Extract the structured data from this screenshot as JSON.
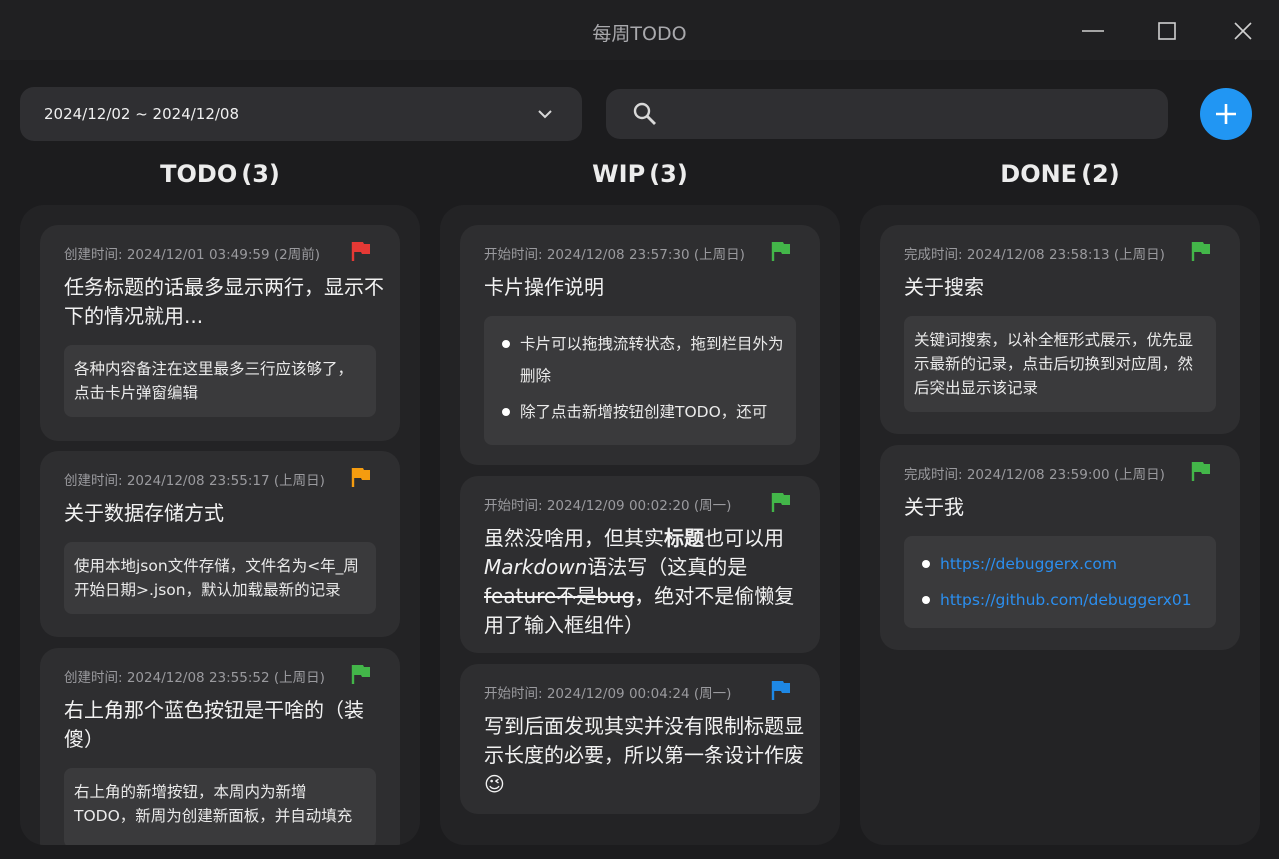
{
  "window": {
    "title": "每周TODO"
  },
  "toolbar": {
    "week_range": "2024/12/02 ~ 2024/12/08",
    "search_placeholder": "",
    "add_icon": "plus-icon",
    "accent": "#2196f3"
  },
  "columns": [
    {
      "name": "TODO",
      "count": "(3)",
      "cards": [
        {
          "meta": "创建时间: 2024/12/01 03:49:59 (2周前)",
          "flag": "#e53935",
          "title": "任务标题的话最多显示两行，显示不下的情况就用...",
          "note": "各种内容备注在这里最多三行应该够了，点击卡片弹窗编辑"
        },
        {
          "meta": "创建时间: 2024/12/08 23:55:17 (上周日)",
          "flag": "#f59c0f",
          "title": "关于数据存储方式",
          "note": "使用本地json文件存储，文件名为<年_周开始日期>.json，默认加载最新的记录"
        },
        {
          "meta": "创建时间: 2024/12/08 23:55:52 (上周日)",
          "flag": "#43b649",
          "title": "右上角那个蓝色按钮是干啥的（装傻）",
          "note": "右上角的新增按钮，本周内为新增TODO，新周为创建新面板，并自动填充"
        }
      ]
    },
    {
      "name": "WIP",
      "count": "(3)",
      "cards": [
        {
          "meta": "开始时间: 2024/12/08 23:57:30 (上周日)",
          "flag": "#43b649",
          "title": "卡片操作说明",
          "bullets": [
            "卡片可以拖拽流转状态，拖到栏目外为删除",
            "除了点击新增按钮创建TODO，还可"
          ]
        },
        {
          "meta": "开始时间: 2024/12/09 00:02:20 (周一)",
          "flag": "#43b649",
          "title_parts": {
            "a": "虽然没啥用，但其实",
            "b": "标题",
            "c": "也可以用",
            "d": "Markdown",
            "e": "语法写（这真的是",
            "f": "feature不是bug",
            "g": "，绝对不是偷懒复用了输入框组件）"
          }
        },
        {
          "meta": "开始时间: 2024/12/09 00:04:24 (周一)",
          "flag": "#1e88e5",
          "title": "写到后面发现其实并没有限制标题显示长度的必要，所以第一条设计作废😉"
        }
      ]
    },
    {
      "name": "DONE",
      "count": "(2)",
      "cards": [
        {
          "meta": "完成时间: 2024/12/08 23:58:13 (上周日)",
          "flag": "#43b649",
          "title": "关于搜索",
          "note": "关键词搜索，以补全框形式展示，优先显示最新的记录，点击后切换到对应周，然后突出显示该记录"
        },
        {
          "meta": "完成时间: 2024/12/08 23:59:00 (上周日)",
          "flag": "#43b649",
          "title": "关于我",
          "links": [
            "https://debuggerx.com",
            "https://github.com/debuggerx01"
          ]
        }
      ]
    }
  ]
}
